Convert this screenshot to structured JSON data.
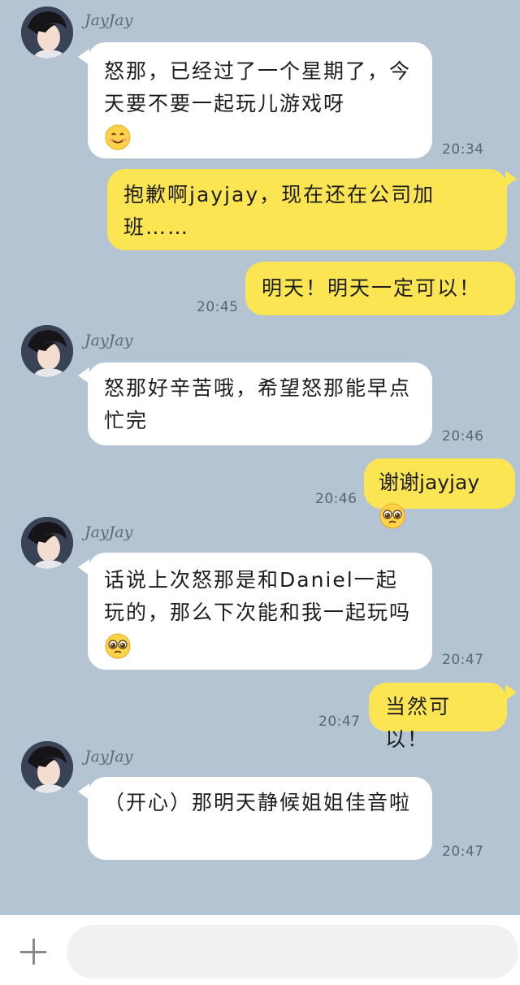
{
  "contact": {
    "name": "JayJay"
  },
  "messages": [
    {
      "id": "m1",
      "side": "in",
      "sender": "JayJay",
      "text": "怒那，已经过了一个星期了，今天要不要一起玩儿游戏呀",
      "emoji": "smiling-face",
      "time": "20:34"
    },
    {
      "id": "m2",
      "side": "out",
      "text": "抱歉啊jayjay，现在还在公司加班……",
      "time": ""
    },
    {
      "id": "m3",
      "side": "out",
      "text": "明天！明天一定可以！",
      "time": "20:45"
    },
    {
      "id": "m4",
      "side": "in",
      "sender": "JayJay",
      "text": "怒那好辛苦哦，希望怒那能早点忙完",
      "time": "20:46"
    },
    {
      "id": "m5",
      "side": "out",
      "text": "谢谢jayjay",
      "emoji": "pleading-face",
      "time": "20:46"
    },
    {
      "id": "m6",
      "side": "in",
      "sender": "JayJay",
      "text": "话说上次怒那是和Daniel一起玩的，那么下次能和我一起玩吗",
      "emoji": "pleading-face",
      "time": "20:47"
    },
    {
      "id": "m7",
      "side": "out",
      "text": "当然可以！",
      "time": "20:47"
    },
    {
      "id": "m8",
      "side": "in",
      "sender": "JayJay",
      "text": "（开心）那明天静候姐姐佳音啦",
      "time": "20:47"
    }
  ],
  "composer": {
    "placeholder": ""
  },
  "colors": {
    "background": "#b4c4d2",
    "incoming": "#ffffff",
    "outgoing": "#fce553"
  }
}
